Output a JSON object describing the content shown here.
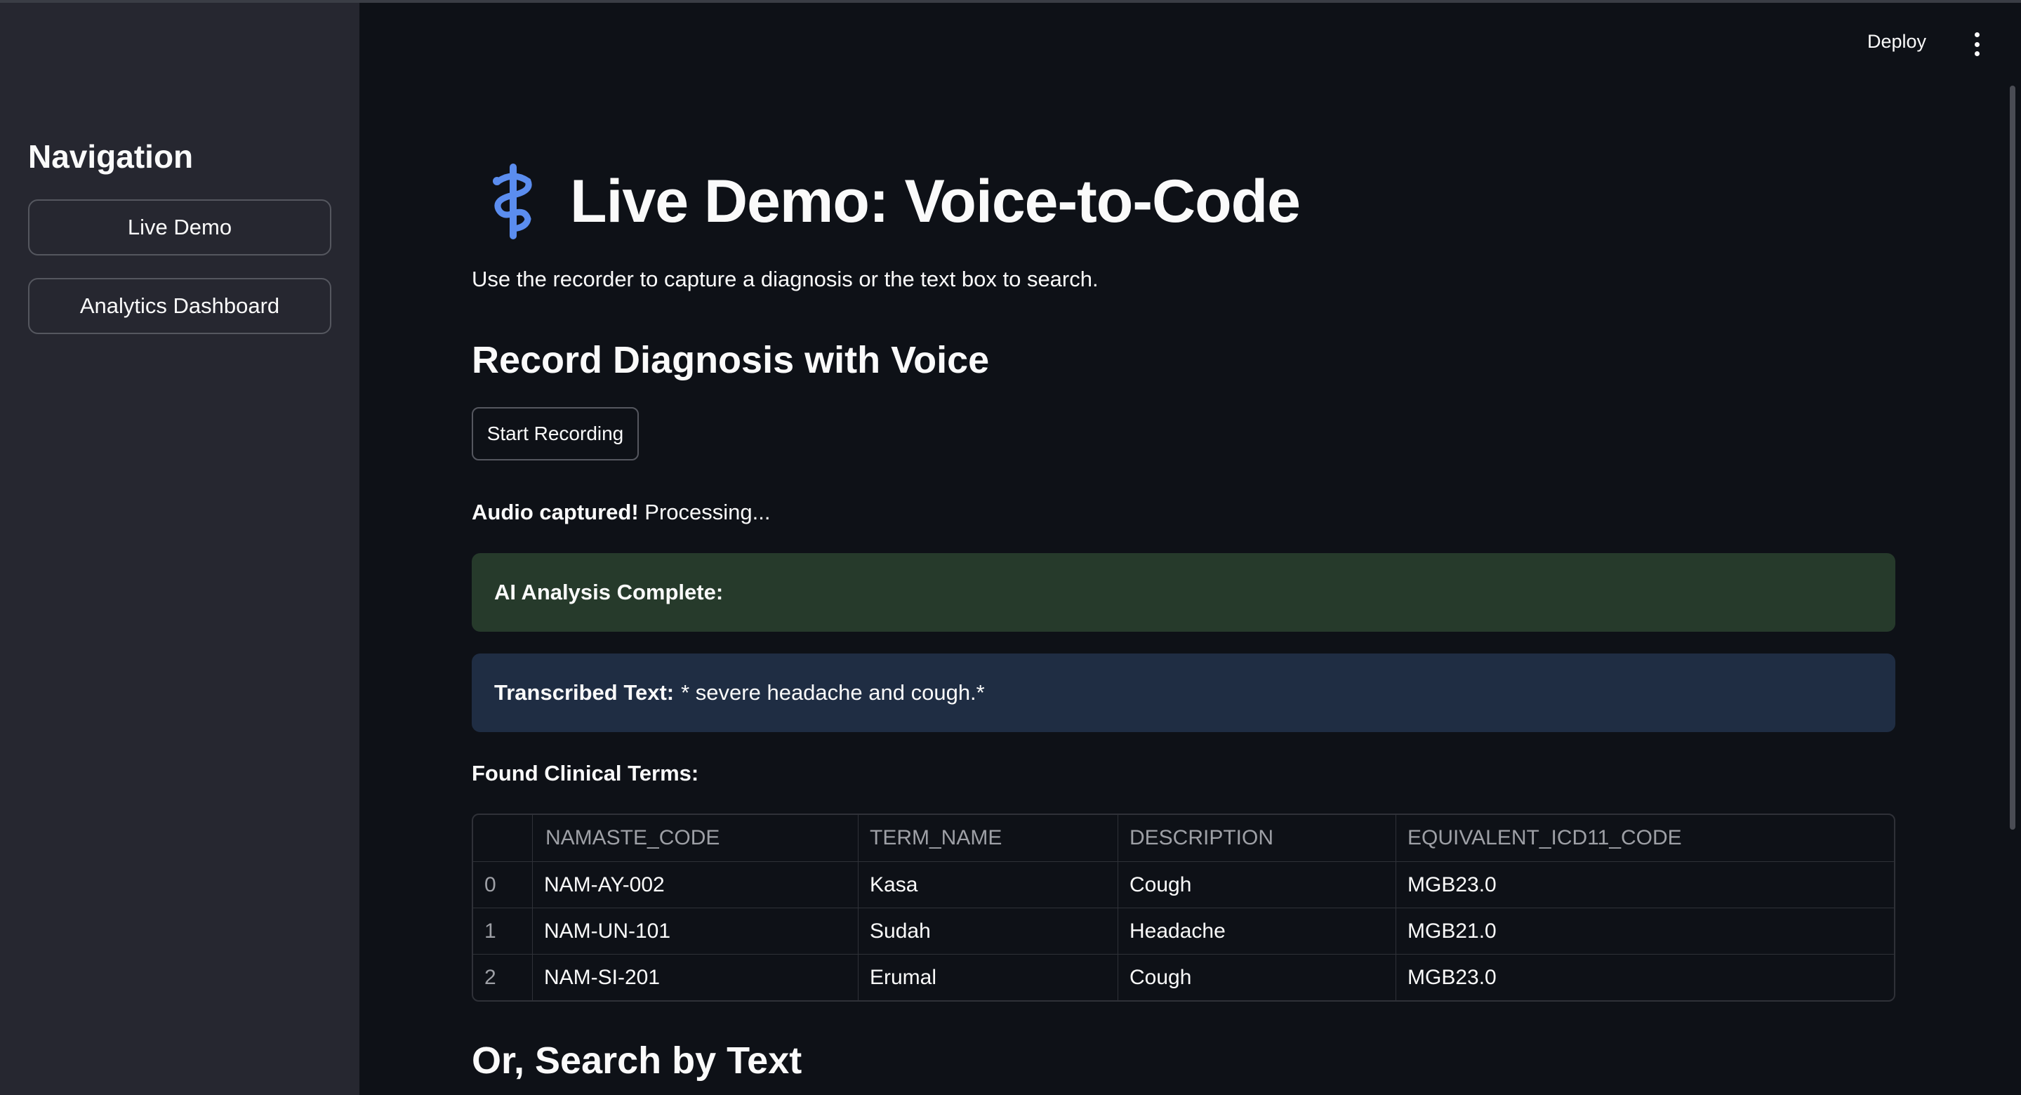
{
  "sidebar": {
    "title": "Navigation",
    "items": [
      {
        "label": "Live Demo"
      },
      {
        "label": "Analytics Dashboard"
      }
    ]
  },
  "header": {
    "deploy_label": "Deploy",
    "menu_icon": "kebab-menu-icon"
  },
  "main": {
    "title_icon": "medical-caduceus-icon",
    "title": "Live Demo: Voice-to-Code",
    "subtitle": "Use the recorder to capture a diagnosis or the text box to search.",
    "record_section_title": "Record Diagnosis with Voice",
    "record_button_label": "Start Recording",
    "captured_bold": "Audio captured!",
    "captured_rest": "Processing...",
    "success_alert": "AI Analysis Complete:",
    "transcribed_label": "Transcribed Text:",
    "transcribed_value": "* severe headache and cough.*",
    "found_terms_label": "Found Clinical Terms:",
    "search_section_title": "Or, Search by Text"
  },
  "table": {
    "columns": [
      "",
      "NAMASTE_CODE",
      "TERM_NAME",
      "DESCRIPTION",
      "EQUIVALENT_ICD11_CODE"
    ],
    "rows": [
      [
        "0",
        "NAM-AY-002",
        "Kasa",
        "Cough",
        "MGB23.0"
      ],
      [
        "1",
        "NAM-UN-101",
        "Sudah",
        "Headache",
        "MGB21.0"
      ],
      [
        "2",
        "NAM-SI-201",
        "Erumal",
        "Cough",
        "MGB23.0"
      ]
    ]
  },
  "colors": {
    "background": "#0e1117",
    "sidebar": "#262730",
    "success_bg": "#263a2b",
    "info_bg": "#1f2d43",
    "icon_blue": "#5b8def"
  }
}
